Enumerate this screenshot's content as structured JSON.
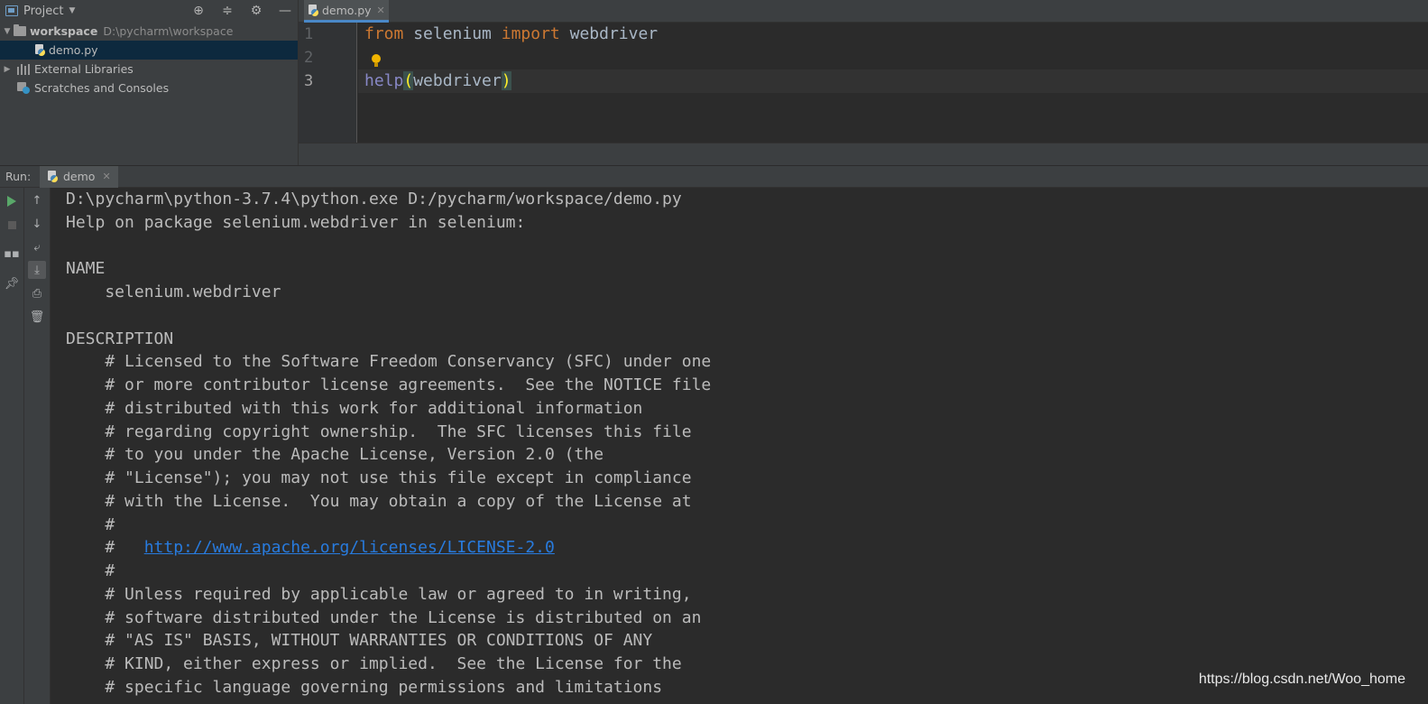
{
  "project_panel": {
    "title": "Project",
    "tree": [
      {
        "label": "workspace",
        "path": "D:\\pycharm\\workspace"
      },
      {
        "label": "demo.py"
      },
      {
        "label": "External Libraries"
      },
      {
        "label": "Scratches and Consoles"
      }
    ]
  },
  "editor": {
    "tab_label": "demo.py",
    "line_numbers": [
      "1",
      "2",
      "3"
    ],
    "code": {
      "line1": {
        "kw_from": "from",
        "module": " selenium ",
        "kw_import": "import",
        "name": " webdriver"
      },
      "line3": {
        "func": "help",
        "open": "(",
        "arg": "webdriver",
        "close": ")"
      }
    }
  },
  "run_panel": {
    "label": "Run:",
    "tab_label": "demo"
  },
  "console": {
    "lines": [
      "D:\\pycharm\\python-3.7.4\\python.exe D:/pycharm/workspace/demo.py",
      "Help on package selenium.webdriver in selenium:",
      "",
      "NAME",
      "    selenium.webdriver",
      "",
      "DESCRIPTION",
      "    # Licensed to the Software Freedom Conservancy (SFC) under one",
      "    # or more contributor license agreements.  See the NOTICE file",
      "    # distributed with this work for additional information",
      "    # regarding copyright ownership.  The SFC licenses this file",
      "    # to you under the Apache License, Version 2.0 (the",
      "    # \"License\"); you may not use this file except in compliance",
      "    # with the License.  You may obtain a copy of the License at",
      "    #",
      "    #   ",
      "    #",
      "    # Unless required by applicable law or agreed to in writing,",
      "    # software distributed under the License is distributed on an",
      "    # \"AS IS\" BASIS, WITHOUT WARRANTIES OR CONDITIONS OF ANY",
      "    # KIND, either express or implied.  See the License for the",
      "    # specific language governing permissions and limitations"
    ],
    "link": "http://www.apache.org/licenses/LICENSE-2.0"
  },
  "watermark": "https://blog.csdn.net/Woo_home"
}
